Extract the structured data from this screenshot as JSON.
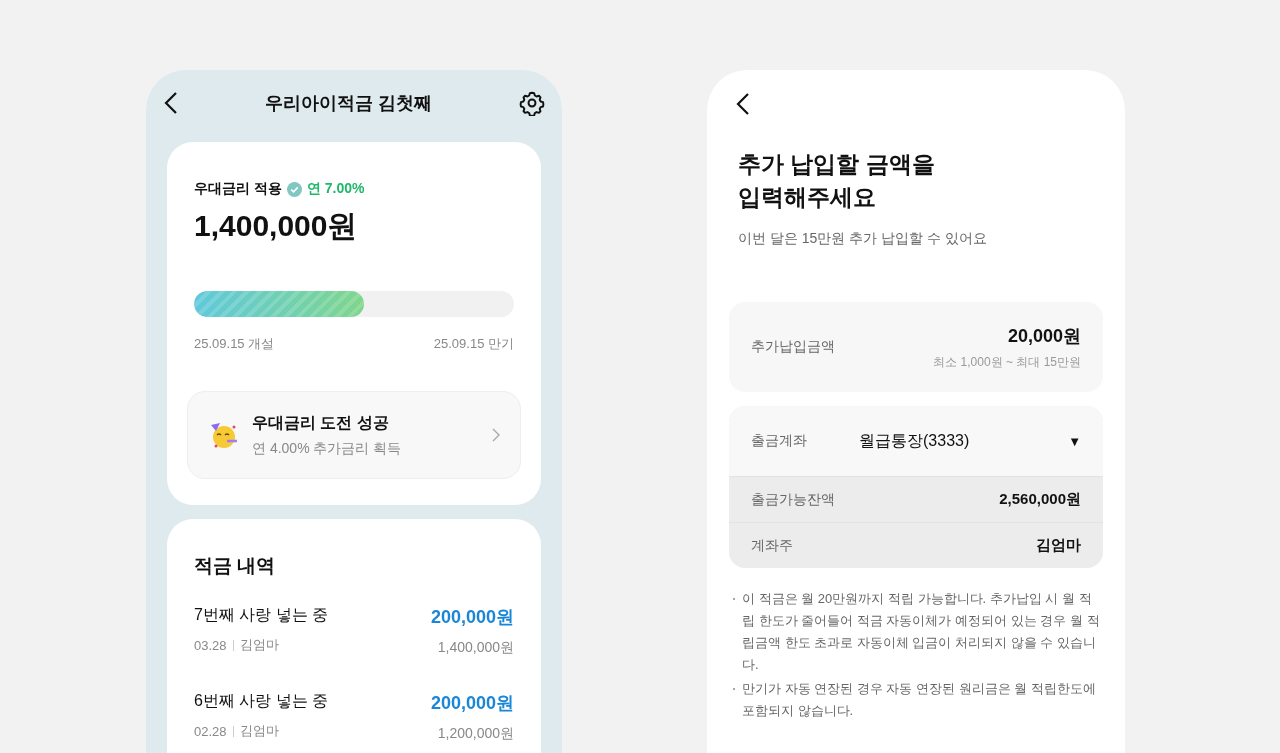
{
  "savings_screen": {
    "title": "우리아이적금 김첫째",
    "summary": {
      "rate_label": "우대금리 적용",
      "rate": "연 7.00%",
      "balance": "1,400,000원",
      "level": 0.53,
      "start": "25.09.15 개설",
      "end": "25.09.15 만기"
    },
    "challenge": {
      "title": "우대금리 도전 성공",
      "subtitle": "연 4.00% 추가금리 획득"
    },
    "history": {
      "title": "적금 내역",
      "rows": [
        {
          "name": "7번째 사랑 넣는 중",
          "date": "03.28",
          "person": "김엄마",
          "amount": "200,000원",
          "total": "1,400,000원"
        },
        {
          "name": "6번째 사랑 넣는 중",
          "date": "02.28",
          "person": "김엄마",
          "amount": "200,000원",
          "total": "1,200,000원"
        }
      ]
    }
  },
  "payment_screen": {
    "heading": "추가 납입할 금액을\n입력해주세요",
    "subtitle": "이번 달은 15만원 추가 납입할 수 있어요",
    "amount": {
      "label": "추가납입금액",
      "value": "20,000원",
      "range": "최소 1,000원 ~ 최대 15만원"
    },
    "account": {
      "label": "출금계좌",
      "value": "월급통장(3333)",
      "caret": "▼"
    },
    "details": [
      {
        "label": "출금가능잔액",
        "value": "2,560,000원"
      },
      {
        "label": "계좌주",
        "value": "김엄마"
      }
    ],
    "notes": [
      "이 적금은 월 20만원까지 적립 가능합니다. 추가납입 시 월 적립 한도가 줄어들어 적금 자동이체가 예정되어 있는 경우 월 적립금액 한도 초과로 자동이체 입금이 처리되지 않을 수 있습니다.",
      "만기가 자동 연장된 경우 자동 연장된 원리금은 월 적립한도에 포함되지 않습니다."
    ]
  }
}
